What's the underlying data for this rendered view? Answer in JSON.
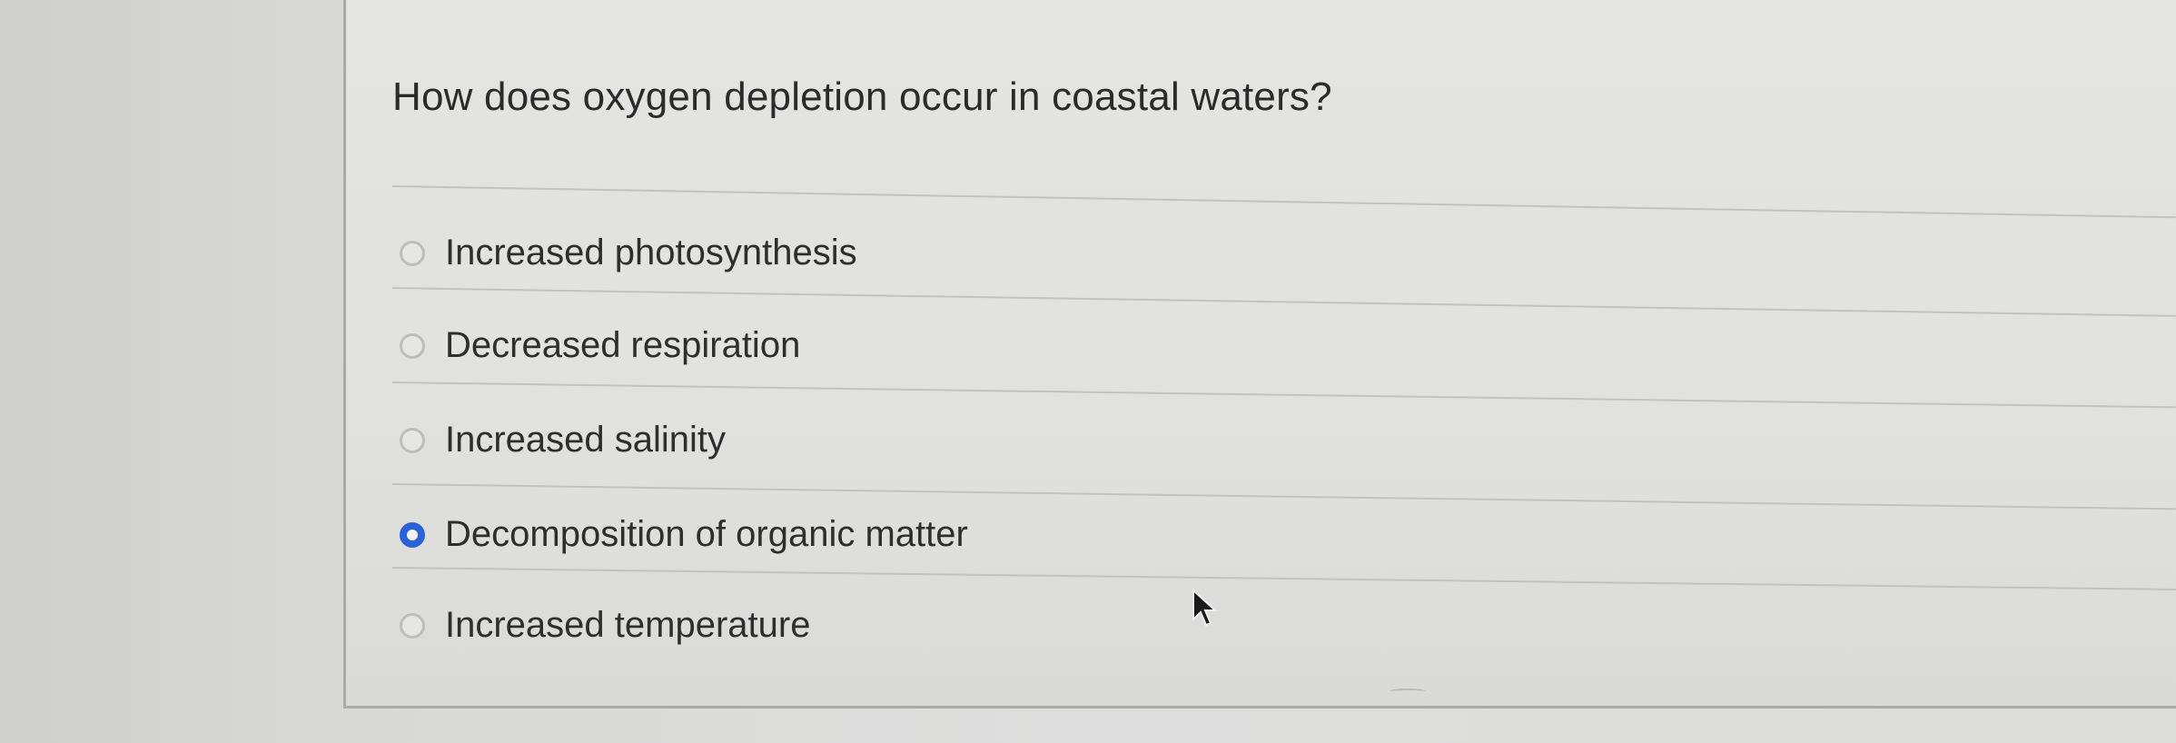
{
  "quiz": {
    "question": "How does oxygen depletion occur in coastal waters?",
    "options": [
      {
        "label": "Increased photosynthesis",
        "selected": false
      },
      {
        "label": "Decreased respiration",
        "selected": false
      },
      {
        "label": "Increased salinity",
        "selected": false
      },
      {
        "label": "Decomposition of organic matter",
        "selected": true
      },
      {
        "label": "Increased temperature",
        "selected": false
      }
    ]
  },
  "colors": {
    "accent": "#2b63d6",
    "text": "#2b2b2b",
    "background": "#e1e1df"
  },
  "icons": {
    "cursor": "arrow-cursor-icon",
    "radio_unchecked": "radio-unchecked-icon",
    "radio_checked": "radio-checked-icon"
  }
}
